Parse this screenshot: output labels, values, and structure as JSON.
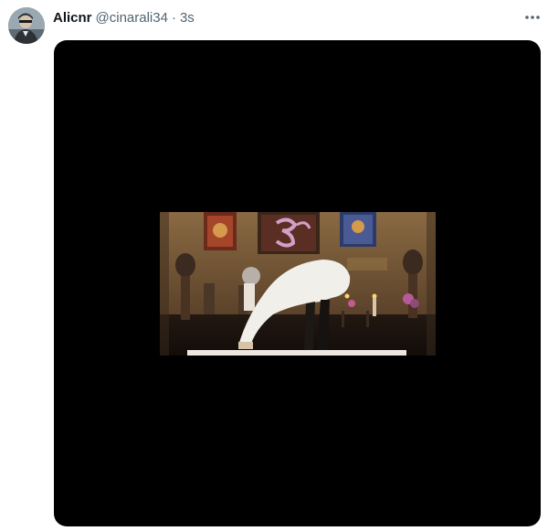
{
  "tweet": {
    "author": {
      "display_name": "Alicnr",
      "handle": "@cinarali34",
      "avatar_icon": "user-avatar"
    },
    "separator": "·",
    "timestamp": "3s",
    "more_icon": "more-horizontal-icon"
  },
  "media": {
    "type": "video",
    "background": "#000000"
  },
  "colors": {
    "text_primary": "#0f1419",
    "text_secondary": "#536471"
  }
}
